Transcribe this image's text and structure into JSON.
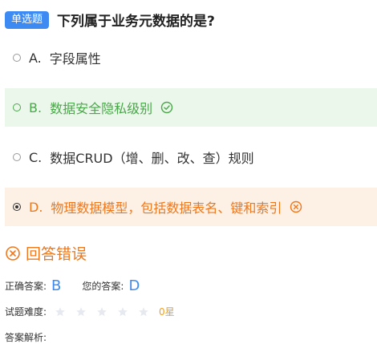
{
  "question": {
    "type_badge": "单选题",
    "title": "下列属于业务元数据的是?"
  },
  "options": [
    {
      "letter": "A.",
      "text": "字段属性"
    },
    {
      "letter": "B.",
      "text": "数据安全隐私级别"
    },
    {
      "letter": "C.",
      "text": "数据CRUD（增、删、改、查）规则"
    },
    {
      "letter": "D.",
      "text": "物理数据模型，包括数据表名、键和索引"
    }
  ],
  "result": {
    "text": "回答错误"
  },
  "answers": {
    "correct_label": "正确答案:",
    "correct_value": "B",
    "yours_label": "您的答案:",
    "yours_value": "D"
  },
  "difficulty": {
    "label": "试题难度:",
    "stars": 0,
    "max_stars": 5,
    "score_text": "0星"
  },
  "analysis": {
    "label": "答案解析:"
  },
  "colors": {
    "accent": "#3d8bf2",
    "correct": "#4aa74a",
    "correct_bg": "#ebf7ea",
    "wrong": "#f0771a",
    "wrong_bg": "#fdf1e6"
  }
}
